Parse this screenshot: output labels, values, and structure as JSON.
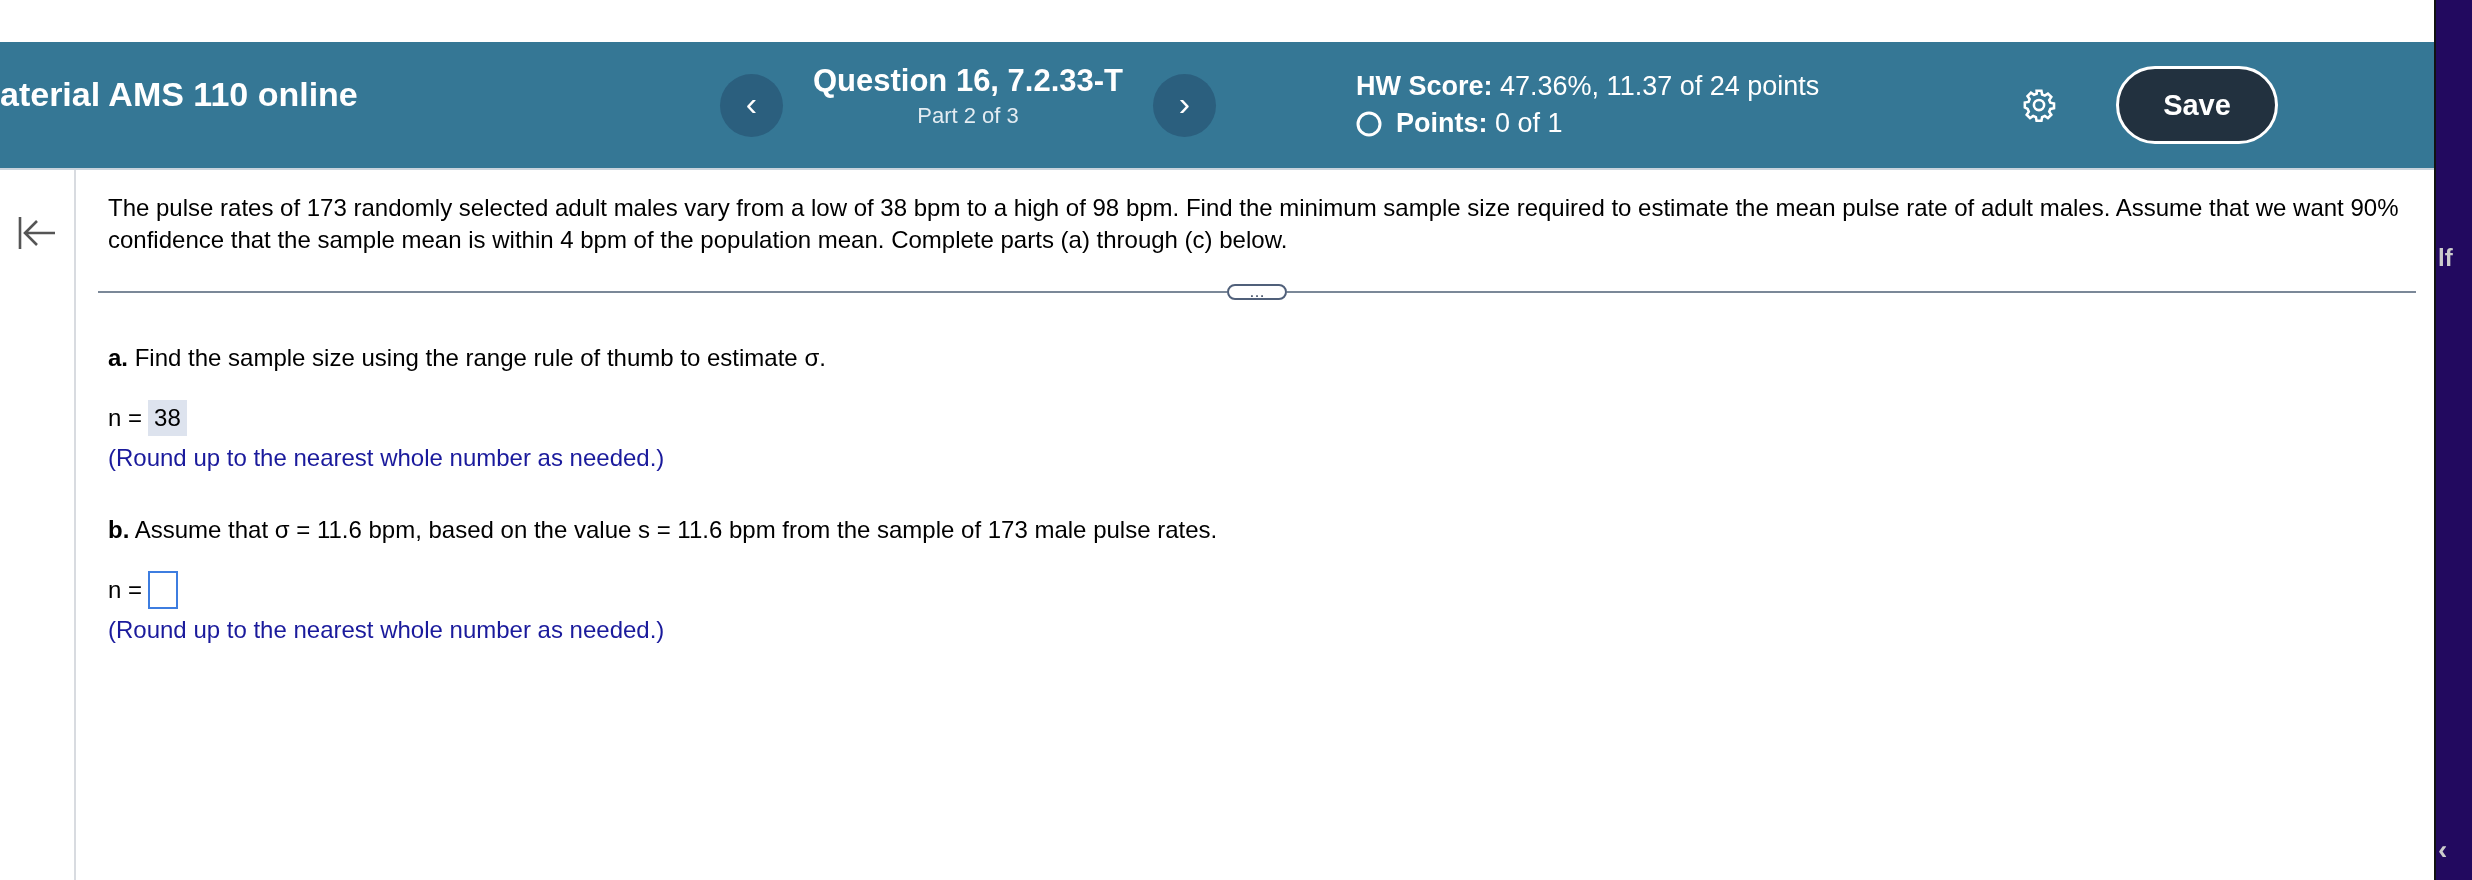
{
  "header": {
    "course_title": "aterial AMS 110 online",
    "question_title": "Question 16, 7.2.33-T",
    "question_part": "Part 2 of 3",
    "previous_button": "‹",
    "next_button": "›",
    "hw_score_label": "HW Score:",
    "hw_score_value": "47.36%, 11.37 of 24 points",
    "points_label": "Points:",
    "points_value": "0 of 1",
    "save_button": "Save"
  },
  "question": {
    "text": "The pulse rates of 173 randomly selected adult males vary from a low of 38 bpm to a high of 98 bpm. Find the minimum sample size required to estimate the mean pulse rate of adult males. Assume that we want 90% confidence that the sample mean is within 4 bpm of the population mean. Complete parts (a) through (c) below.",
    "expand_button": "…",
    "parts": [
      {
        "prompt": "**a.** Find the sample size using the range rule of thumb to estimate σ.",
        "answer_label": "n =",
        "kind": "answered",
        "answer_value": "38",
        "hint": "(Round up to the nearest whole number as needed.)"
      },
      {
        "prompt": "**b.** Assume that σ = 11.6 bpm, based on the value s = 11.6 bpm from the sample of 173 male pulse rates.",
        "answer_label": "n =",
        "kind": "empty",
        "hint": "(Round up to the nearest whole number as needed.)"
      }
    ]
  },
  "side_panel": {
    "label": "lf",
    "collapse_button": "‹"
  }
}
